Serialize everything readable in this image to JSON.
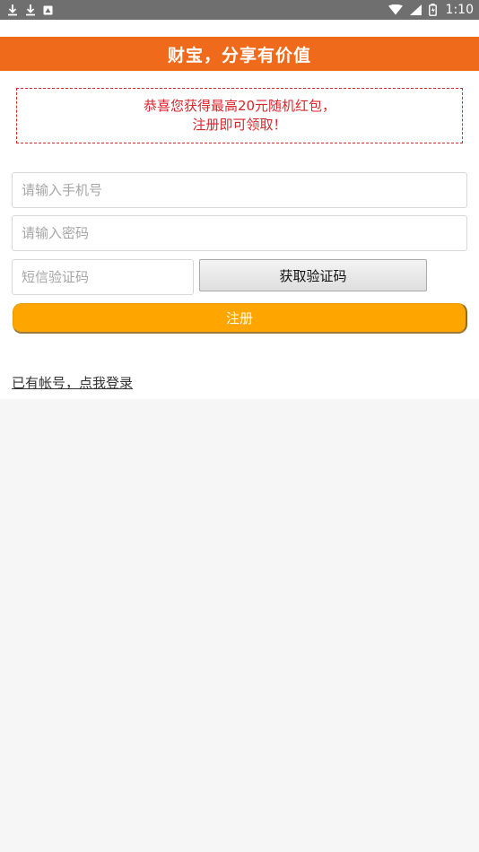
{
  "status_bar": {
    "time": "1:10",
    "icons": [
      "download-icon",
      "download-icon",
      "notification-icon",
      "wifi-icon",
      "signal-icon",
      "battery-icon"
    ]
  },
  "header": {
    "title": "财宝，分享有价值"
  },
  "notice": {
    "line1": "恭喜您获得最高20元随机红包，",
    "line2": "注册即可领取！"
  },
  "form": {
    "phone_placeholder": "请输入手机号",
    "password_placeholder": "请输入密码",
    "sms_placeholder": "短信验证码",
    "get_code_label": "获取验证码",
    "register_label": "注册"
  },
  "footer": {
    "login_link": "已有帐号，点我登录"
  },
  "colors": {
    "header_bg": "#f06a1c",
    "notice_red": "#d9262c",
    "register_bg": "#ffa500",
    "status_bar_bg": "#6f6f6f"
  }
}
